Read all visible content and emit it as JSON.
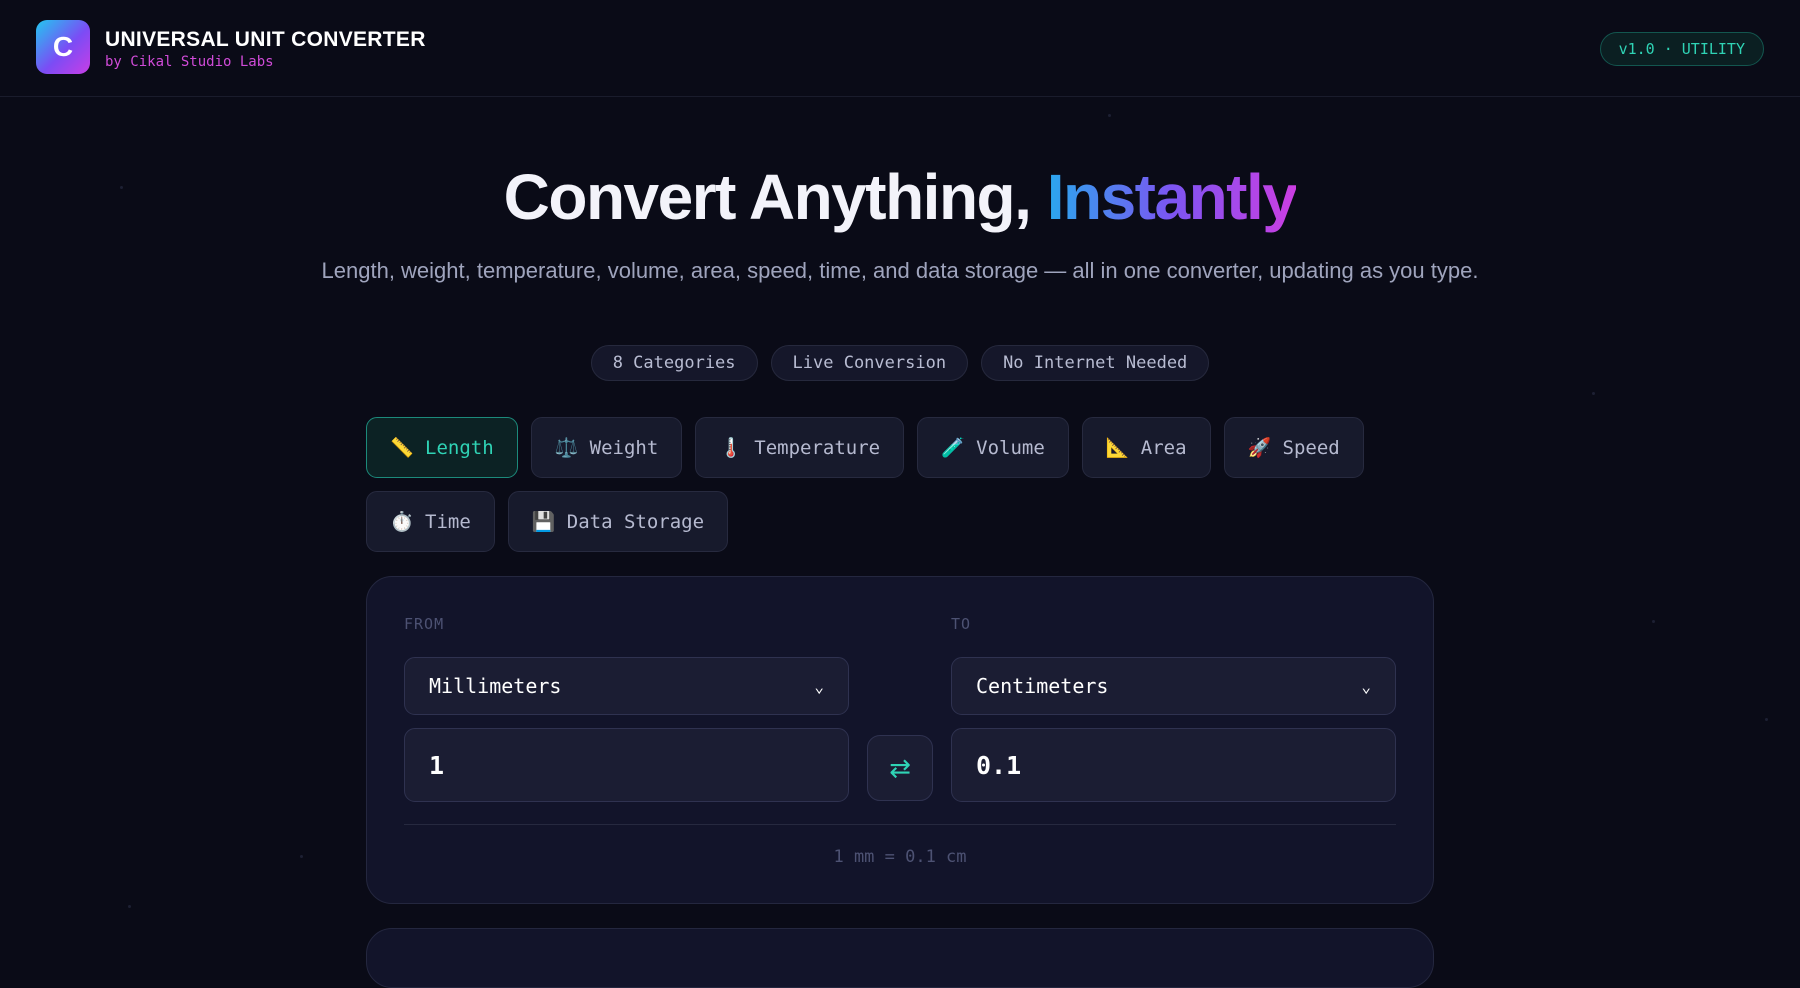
{
  "header": {
    "logo_letter": "C",
    "title": "UNIVERSAL UNIT CONVERTER",
    "subtitle": "by Cikal Studio Labs",
    "version_badge": "v1.0 · UTILITY"
  },
  "hero": {
    "title_main": "Convert Anything, ",
    "title_accent": "Instantly",
    "subtitle": "Length, weight, temperature, volume, area, speed, time, and data storage — all in one converter, updating as you type.",
    "pills": [
      "8 Categories",
      "Live Conversion",
      "No Internet Needed"
    ]
  },
  "categories": [
    {
      "label": "Length",
      "icon": "ruler-icon",
      "glyph": "📏",
      "active": true
    },
    {
      "label": "Weight",
      "icon": "scale-icon",
      "glyph": "⚖️",
      "active": false
    },
    {
      "label": "Temperature",
      "icon": "thermometer-icon",
      "glyph": "🌡️",
      "active": false
    },
    {
      "label": "Volume",
      "icon": "test-tube-icon",
      "glyph": "🧪",
      "active": false
    },
    {
      "label": "Area",
      "icon": "triangle-ruler-icon",
      "glyph": "📐",
      "active": false
    },
    {
      "label": "Speed",
      "icon": "rocket-icon",
      "glyph": "🚀",
      "active": false
    },
    {
      "label": "Time",
      "icon": "stopwatch-icon",
      "glyph": "⏱️",
      "active": false
    },
    {
      "label": "Data Storage",
      "icon": "floppy-disk-icon",
      "glyph": "💾",
      "active": false
    }
  ],
  "converter": {
    "from_label": "FROM",
    "to_label": "TO",
    "from_unit": "Millimeters",
    "to_unit": "Centimeters",
    "from_value": "1",
    "to_value": "0.1",
    "swap_glyph": "⇄",
    "formula": "1 mm = 0.1 cm"
  },
  "colors": {
    "background": "#0a0b17",
    "accent_teal": "#2fd3b5",
    "accent_magenta": "#d04bd8",
    "gradient_start": "#2aa8ee",
    "gradient_end": "#cc3ee2"
  }
}
